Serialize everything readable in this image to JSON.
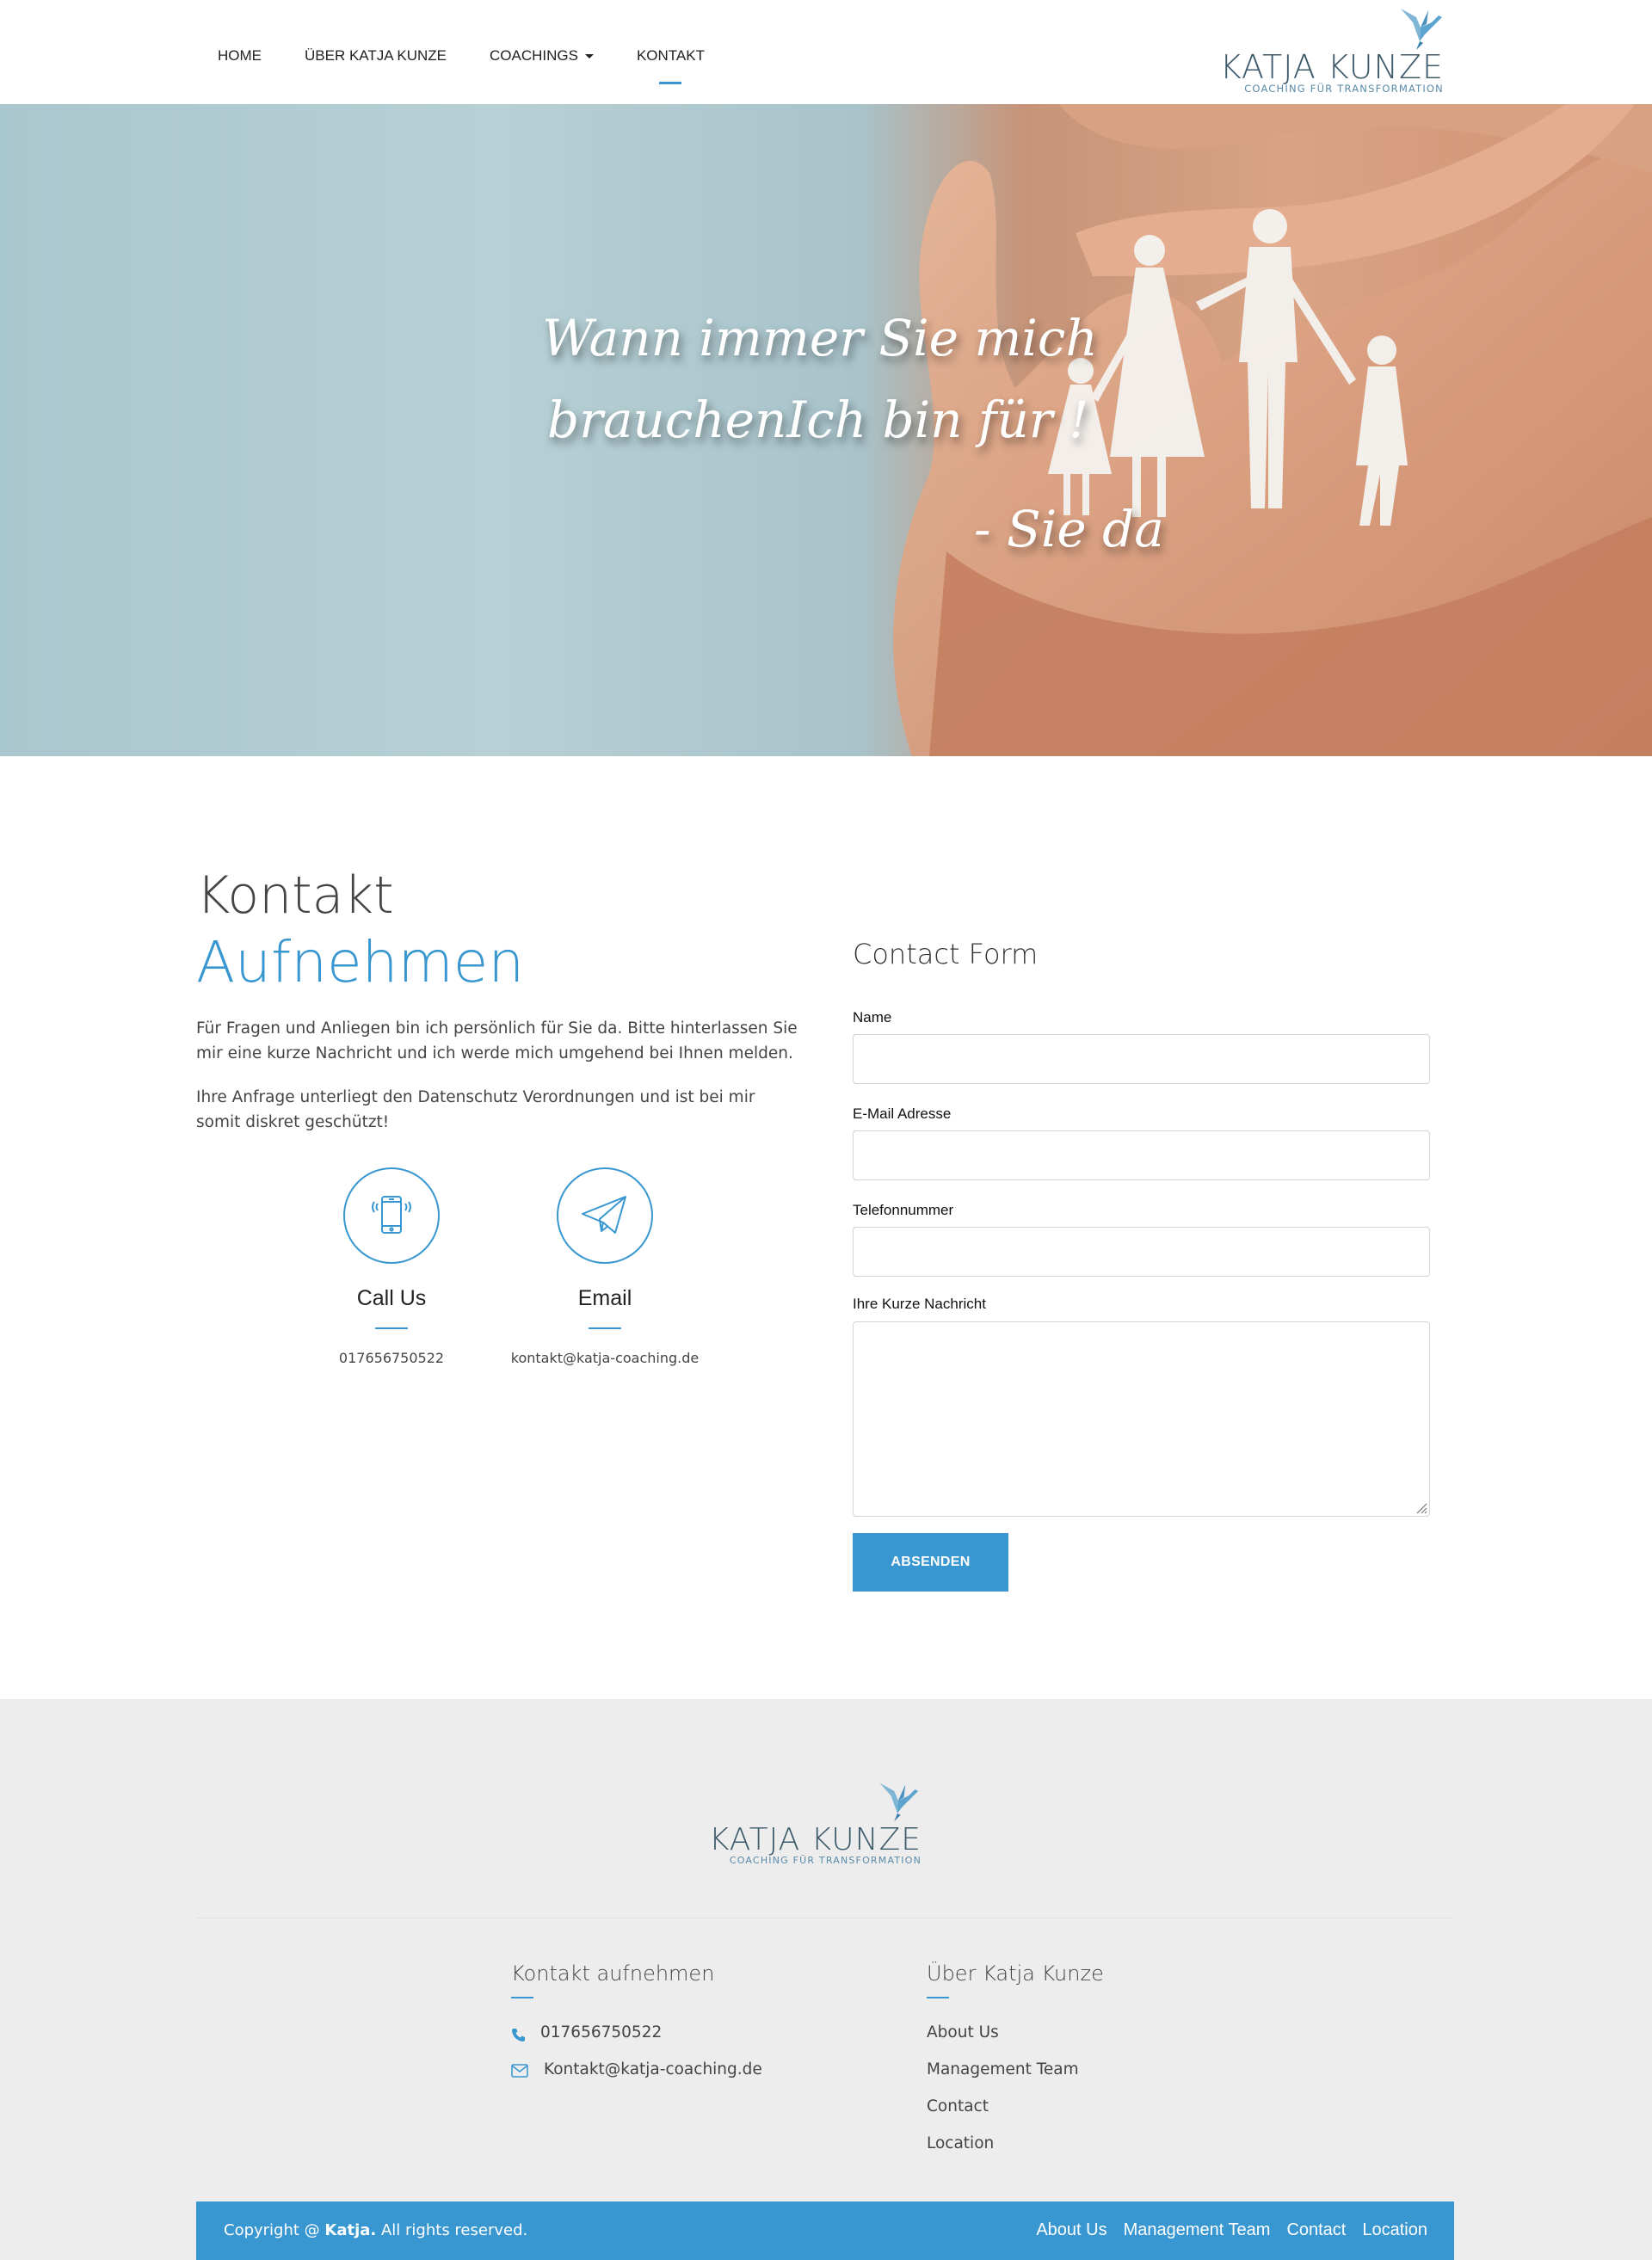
{
  "nav": {
    "items": [
      {
        "label": "HOME"
      },
      {
        "label": "ÜBER KATJA KUNZE"
      },
      {
        "label": "COACHINGS"
      },
      {
        "label": "KONTAKT"
      }
    ]
  },
  "logo": {
    "name": "KATJA KUNZE",
    "tagline": "COACHING FÜR TRANSFORMATION"
  },
  "hero": {
    "quote_line1": "Wann immer Sie mich",
    "quote_line2": "brauchenIch bin für !",
    "quote_line3": "- Sie da"
  },
  "contact": {
    "title_line1": "Kontakt",
    "title_line2": "Aufnehmen",
    "paragraph1": "Für Fragen und Anliegen bin ich persönlich für Sie da. Bitte hinterlassen Sie mir eine kurze Nachricht und ich werde mich umgehend bei Ihnen melden.",
    "paragraph2": "Ihre Anfrage unterliegt den Datenschutz Verordnungen und ist bei mir somit diskret geschützt!",
    "call_title": "Call Us",
    "call_value": "017656750522",
    "email_title": "Email",
    "email_value": "kontakt@katja-coaching.de"
  },
  "form": {
    "title": "Contact Form",
    "name_label": "Name",
    "email_label": "E-Mail Adresse",
    "phone_label": "Telefonnummer",
    "message_label": "Ihre Kurze Nachricht",
    "submit_label": "ABSENDEN"
  },
  "footer": {
    "contact_heading": "Kontakt aufnehmen",
    "phone": "017656750522",
    "email": "Kontakt@katja-coaching.de",
    "about_heading": "Über Katja Kunze",
    "about_links": [
      "About Us",
      "Management Team",
      "Contact",
      "Location"
    ],
    "copyright_prefix": "Copyright @ ",
    "copyright_name": "Katja.",
    "copyright_suffix": " All rights reserved.",
    "bottom_links": [
      "About Us",
      "Management Team",
      "Contact",
      "Location"
    ]
  },
  "colors": {
    "accent": "#3897d0",
    "footer_bg": "#ededed",
    "logo_text": "#3d5a6a"
  },
  "icons": [
    "bird-logo-icon",
    "caret-down-icon",
    "phone-icon",
    "paper-plane-icon",
    "phone-small-icon",
    "envelope-icon",
    "resize-grip-icon"
  ]
}
